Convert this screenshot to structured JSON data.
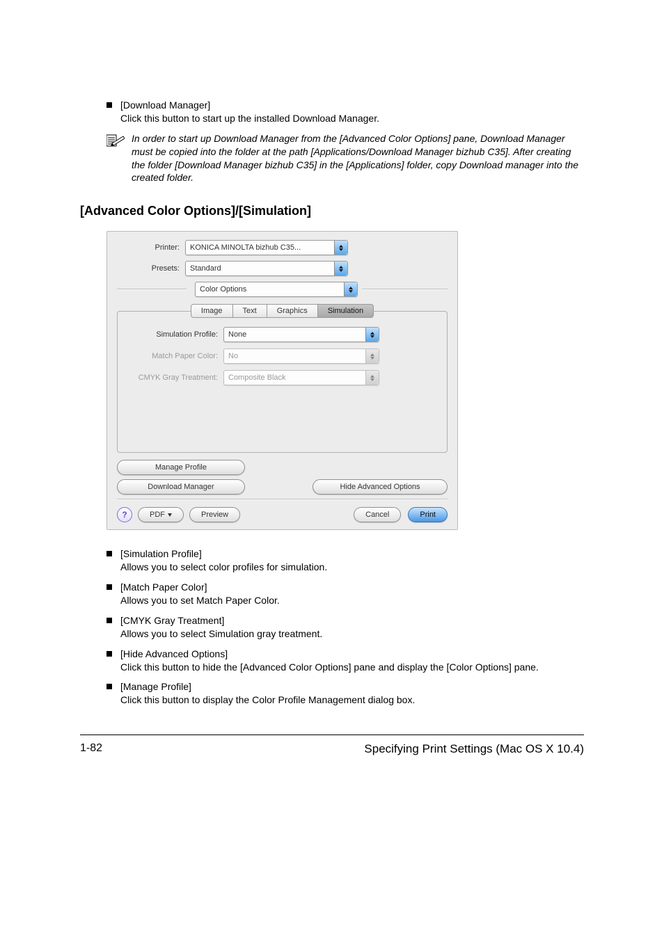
{
  "top_list": {
    "item1_title": "[Download Manager]",
    "item1_text": "Click this button to start up the installed Download Manager."
  },
  "note": "In order to start up Download Manager from the [Advanced Color Options] pane, Download Manager must be copied into the folder at the path [Applications/Download Manager bizhub C35]. After creating the folder [Download Manager bizhub C35] in the [Applications] folder, copy Download manager into the created folder.",
  "section_heading": "[Advanced Color Options]/[Simulation]",
  "dialog": {
    "printer_label": "Printer:",
    "printer_value": "KONICA MINOLTA bizhub C35...",
    "presets_label": "Presets:",
    "presets_value": "Standard",
    "pane_value": "Color Options",
    "tabs": {
      "image": "Image",
      "text": "Text",
      "graphics": "Graphics",
      "simulation": "Simulation"
    },
    "sim_profile_label": "Simulation Profile:",
    "sim_profile_value": "None",
    "match_paper_label": "Match Paper Color:",
    "match_paper_value": "No",
    "cmyk_label": "CMYK Gray Treatment:",
    "cmyk_value": "Composite Black",
    "manage_profile": "Manage Profile",
    "download_manager": "Download Manager",
    "hide_adv": "Hide Advanced Options",
    "help": "?",
    "pdf": "PDF",
    "preview": "Preview",
    "cancel": "Cancel",
    "print": "Print"
  },
  "below_list": {
    "b1_title": "[Simulation Profile]",
    "b1_text": "Allows you to select color profiles for simulation.",
    "b2_title": "[Match Paper Color]",
    "b2_text": "Allows you to set Match Paper Color.",
    "b3_title": "[CMYK Gray Treatment]",
    "b3_text": "Allows you to select Simulation gray treatment.",
    "b4_title": "[Hide Advanced Options]",
    "b4_text": "Click this button to hide the [Advanced Color Options] pane and display the [Color Options] pane.",
    "b5_title": "[Manage Profile]",
    "b5_text": "Click this button to display the Color Profile Management dialog box."
  },
  "footer": {
    "page": "1-82",
    "title": "Specifying Print Settings (Mac OS X 10.4)"
  }
}
